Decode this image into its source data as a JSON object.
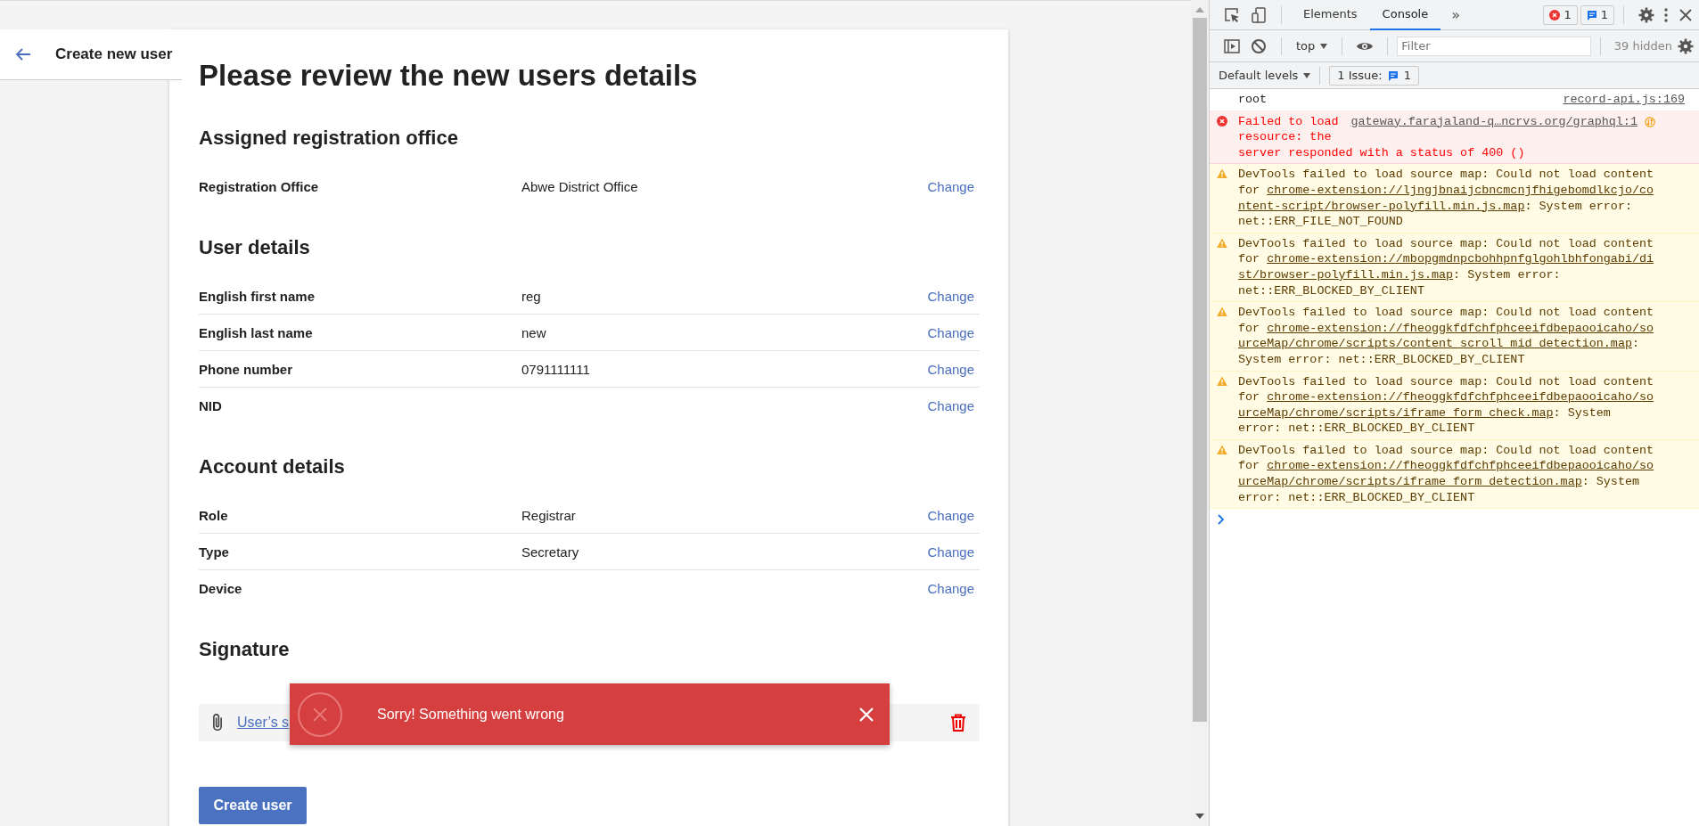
{
  "page": {
    "header": {
      "title": "Create new user"
    },
    "heading": "Please review the new users details",
    "sections": [
      {
        "title": "Assigned registration office",
        "rows": [
          {
            "label": "Registration Office",
            "value": "Abwe District Office",
            "action": "Change"
          }
        ]
      },
      {
        "title": "User details",
        "rows": [
          {
            "label": "English first name",
            "value": "reg",
            "action": "Change"
          },
          {
            "label": "English last name",
            "value": "new",
            "action": "Change"
          },
          {
            "label": "Phone number",
            "value": "0791111111",
            "action": "Change"
          },
          {
            "label": "NID",
            "action": "Change"
          }
        ]
      },
      {
        "title": "Account details",
        "rows": [
          {
            "label": "Role",
            "value": "Registrar",
            "action": "Change"
          },
          {
            "label": "Type",
            "value": "Secretary",
            "action": "Change"
          },
          {
            "label": "Device",
            "action": "Change"
          }
        ]
      }
    ],
    "signature": {
      "title": "Signature",
      "file_link": "User’s s"
    },
    "submit_button": "Create user",
    "toast": {
      "message": "Sorry! Something went wrong"
    }
  },
  "devtools": {
    "tabs": [
      {
        "label": "Elements",
        "selected": false
      },
      {
        "label": "Console",
        "selected": true
      }
    ],
    "more_tabs": "»",
    "error_count": "1",
    "message_count": "1",
    "context": "top",
    "filter": {
      "placeholder": "Filter"
    },
    "hidden_count": "39 hidden",
    "levels": "Default levels",
    "issues": {
      "label": "1 Issue:",
      "count": "1"
    },
    "messages": [
      {
        "kind": "log",
        "text": "root",
        "source": "record-api.js:169"
      },
      {
        "kind": "error",
        "text": "Failed to load",
        "link": "gateway.farajaland-q…ncrvs.org/graphql:1",
        "after": "resource: the\nserver responded with a status of 400 ()"
      },
      {
        "kind": "warning",
        "text": "DevTools failed to load source map: Could not load content for ",
        "link": "chrome-extension://ljngjbnaijcbncmcnjfhigebomdlkcjo/content-script/browser-polyfill.min.js.map",
        "after": ": System error: net::ERR_FILE_NOT_FOUND"
      },
      {
        "kind": "warning",
        "text": "DevTools failed to load source map: Could not load content for ",
        "link": "chrome-extension://mbopgmdnpcbohhpnfglgohlbhfongabi/dist/browser-polyfill.min.js.map",
        "after": ": System error: net::ERR_BLOCKED_BY_CLIENT"
      },
      {
        "kind": "warning",
        "text": "DevTools failed to load source map: Could not load content for ",
        "link": "chrome-extension://fheoggkfdfchfphceeifdbepaooicaho/sourceMap/chrome/scripts/content_scroll_mid_detection.map",
        "after": ": System error: net::ERR_BLOCKED_BY_CLIENT"
      },
      {
        "kind": "warning",
        "text": "DevTools failed to load source map: Could not load content for ",
        "link": "chrome-extension://fheoggkfdfchfphceeifdbepaooicaho/sourceMap/chrome/scripts/iframe_form_check.map",
        "after": ": System error: net::ERR_BLOCKED_BY_CLIENT"
      },
      {
        "kind": "warning",
        "text": "DevTools failed to load source map: Could not load content for ",
        "link": "chrome-extension://fheoggkfdfchfphceeifdbepaooicaho/sourceMap/chrome/scripts/iframe_form_detection.map",
        "after": ": System error: net::ERR_BLOCKED_BY_CLIENT"
      }
    ]
  }
}
